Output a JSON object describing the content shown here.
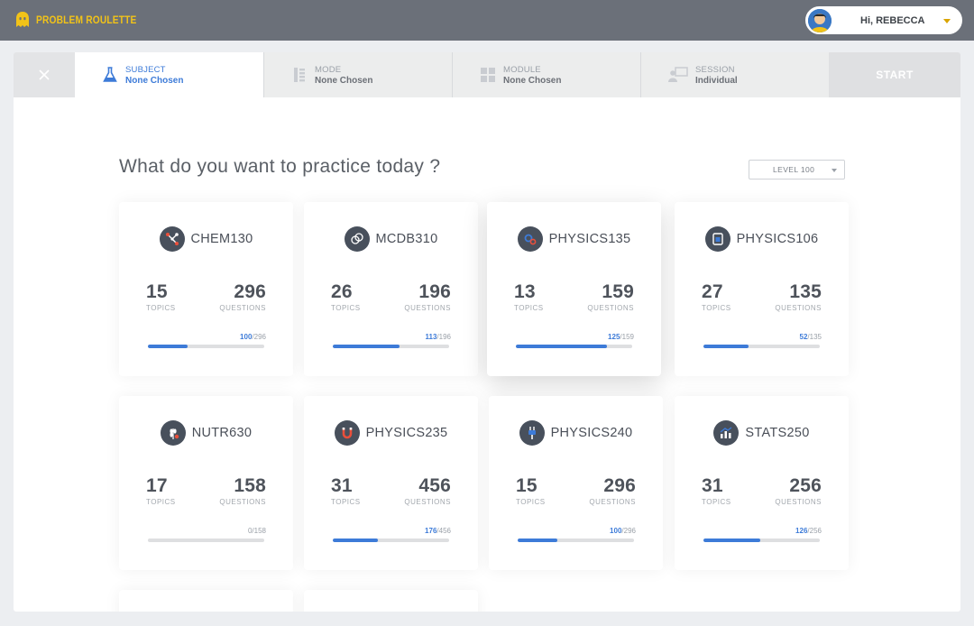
{
  "app": {
    "name": "PROBLEM ROULETTE"
  },
  "user": {
    "greeting": "Hi, REBECCA"
  },
  "steps": [
    {
      "kicker": "SUBJECT",
      "value": "None Chosen",
      "icon": "flask-icon"
    },
    {
      "kicker": "MODE",
      "value": "None Chosen",
      "icon": "list-icon"
    },
    {
      "kicker": "MODULE",
      "value": "None Chosen",
      "icon": "grid-icon"
    },
    {
      "kicker": "SESSION",
      "value": "Individual",
      "icon": "presenter-icon"
    }
  ],
  "start_label": "START",
  "main": {
    "question": "What do you want to practice today ?",
    "level": "LEVEL 100"
  },
  "labels": {
    "topics": "TOPICS",
    "questions": "QUESTIONS"
  },
  "subjects": [
    {
      "name": "CHEM130",
      "topics": "15",
      "questions": "296",
      "done": "100",
      "total": "296",
      "fraction": 0.338,
      "icon": "molecule-icon"
    },
    {
      "name": "MCDB310",
      "topics": "26",
      "questions": "196",
      "done": "113",
      "total": "196",
      "fraction": 0.577,
      "icon": "cells-icon"
    },
    {
      "name": "PHYSICS135",
      "topics": "13",
      "questions": "159",
      "done": "125",
      "total": "159",
      "fraction": 0.786,
      "icon": "gears-icon"
    },
    {
      "name": "PHYSICS106",
      "topics": "27",
      "questions": "135",
      "done": "52",
      "total": "135",
      "fraction": 0.385,
      "icon": "device-icon"
    },
    {
      "name": "NUTR630",
      "topics": "17",
      "questions": "158",
      "done": "0",
      "total": "158",
      "fraction": 0.0,
      "icon": "wheat-icon"
    },
    {
      "name": "PHYSICS235",
      "topics": "31",
      "questions": "456",
      "done": "176",
      "total": "456",
      "fraction": 0.386,
      "icon": "magnet-icon"
    },
    {
      "name": "PHYSICS240",
      "topics": "15",
      "questions": "296",
      "done": "100",
      "total": "296",
      "fraction": 0.338,
      "icon": "plug-icon"
    },
    {
      "name": "STATS250",
      "topics": "31",
      "questions": "256",
      "done": "126",
      "total": "256",
      "fraction": 0.492,
      "icon": "chart-icon"
    }
  ],
  "colors": {
    "accent": "#3d7bd8",
    "logo": "#f2c318",
    "topbar": "#6b7079"
  }
}
